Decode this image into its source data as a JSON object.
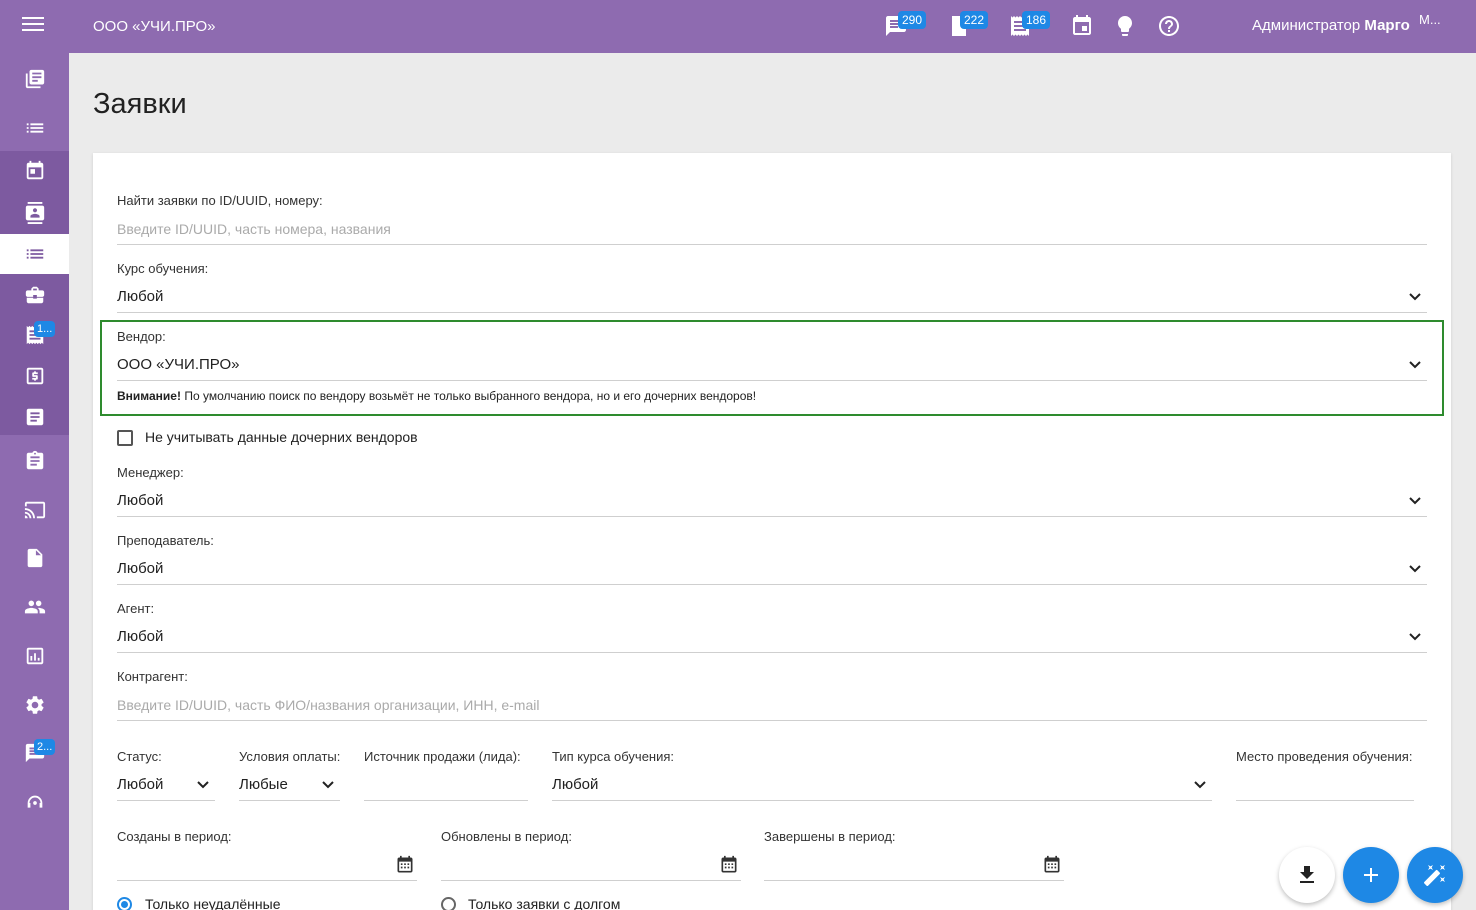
{
  "header": {
    "company": "ООО «УЧИ.ПРО»",
    "badges": [
      "290",
      "222",
      "186"
    ],
    "user_prefix": "Администратор",
    "user_name": "Марго",
    "avatar_alt": "M..."
  },
  "sidebar": {
    "badges": [
      "1...",
      "2..."
    ]
  },
  "page": {
    "title": "Заявки"
  },
  "form": {
    "search": {
      "label": "Найти заявки по ID/UUID, номеру:",
      "placeholder": "Введите ID/UUID, часть номера, названия"
    },
    "course": {
      "label": "Курс обучения:",
      "value": "Любой"
    },
    "vendor": {
      "label": "Вендор:",
      "value": "ООО «УЧИ.ПРО»",
      "notice_bold": "Внимание!",
      "notice": " По умолчанию поиск по вендору возьмёт не только выбранного вендора, но и его дочерних вендоров!"
    },
    "child_vendors_checkbox": "Не учитывать данные дочерних вендоров",
    "manager": {
      "label": "Менеджер:",
      "value": "Любой"
    },
    "teacher": {
      "label": "Преподаватель:",
      "value": "Любой"
    },
    "agent": {
      "label": "Агент:",
      "value": "Любой"
    },
    "counterparty": {
      "label": "Контрагент:",
      "placeholder": "Введите ID/UUID, часть ФИО/названия организации, ИНН, e-mail"
    },
    "status": {
      "label": "Статус:",
      "value": "Любой"
    },
    "payment": {
      "label": "Условия оплаты:",
      "value": "Любые"
    },
    "source": {
      "label": "Источник продажи (лида):",
      "value": ""
    },
    "course_type": {
      "label": "Тип курса обучения:",
      "value": "Любой"
    },
    "place": {
      "label": "Место проведения обучения:",
      "value": ""
    },
    "created": {
      "label": "Созданы в период:"
    },
    "updated": {
      "label": "Обновлены в период:"
    },
    "finished": {
      "label": "Завершены в период:"
    },
    "radio_not_deleted": "Только неудалённые",
    "radio_debt": "Только заявки с долгом"
  }
}
